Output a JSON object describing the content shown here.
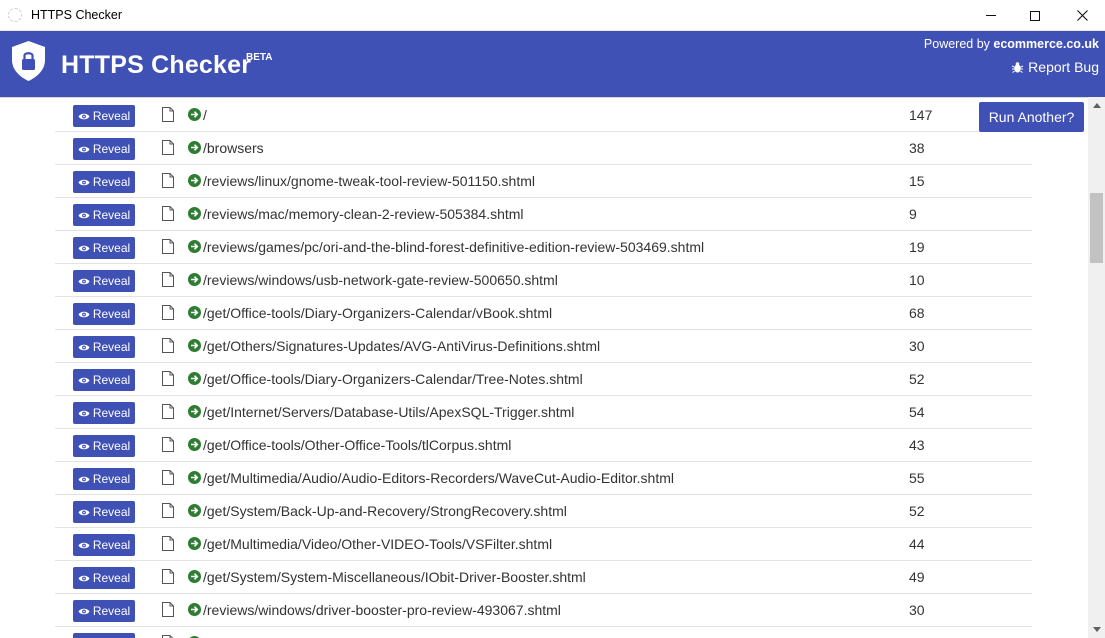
{
  "window": {
    "title": "HTTPS Checker"
  },
  "header": {
    "title": "HTTPS Checker",
    "badge": "BETA",
    "powered_prefix": "Powered by ",
    "powered_brand": "ecommerce.co.uk",
    "report_bug": "Report Bug"
  },
  "actions": {
    "run_another": "Run Another?"
  },
  "results": [
    {
      "reveal": "Reveal",
      "path": "/",
      "count": "147"
    },
    {
      "reveal": "Reveal",
      "path": "/browsers",
      "count": "38"
    },
    {
      "reveal": "Reveal",
      "path": "/reviews/linux/gnome-tweak-tool-review-501150.shtml",
      "count": "15"
    },
    {
      "reveal": "Reveal",
      "path": "/reviews/mac/memory-clean-2-review-505384.shtml",
      "count": "9"
    },
    {
      "reveal": "Reveal",
      "path": "/reviews/games/pc/ori-and-the-blind-forest-definitive-edition-review-503469.shtml",
      "count": "19"
    },
    {
      "reveal": "Reveal",
      "path": "/reviews/windows/usb-network-gate-review-500650.shtml",
      "count": "10"
    },
    {
      "reveal": "Reveal",
      "path": "/get/Office-tools/Diary-Organizers-Calendar/vBook.shtml",
      "count": "68"
    },
    {
      "reveal": "Reveal",
      "path": "/get/Others/Signatures-Updates/AVG-AntiVirus-Definitions.shtml",
      "count": "30"
    },
    {
      "reveal": "Reveal",
      "path": "/get/Office-tools/Diary-Organizers-Calendar/Tree-Notes.shtml",
      "count": "52"
    },
    {
      "reveal": "Reveal",
      "path": "/get/Internet/Servers/Database-Utils/ApexSQL-Trigger.shtml",
      "count": "54"
    },
    {
      "reveal": "Reveal",
      "path": "/get/Office-tools/Other-Office-Tools/tlCorpus.shtml",
      "count": "43"
    },
    {
      "reveal": "Reveal",
      "path": "/get/Multimedia/Audio/Audio-Editors-Recorders/WaveCut-Audio-Editor.shtml",
      "count": "55"
    },
    {
      "reveal": "Reveal",
      "path": "/get/System/Back-Up-and-Recovery/StrongRecovery.shtml",
      "count": "52"
    },
    {
      "reveal": "Reveal",
      "path": "/get/Multimedia/Video/Other-VIDEO-Tools/VSFilter.shtml",
      "count": "44"
    },
    {
      "reveal": "Reveal",
      "path": "/get/System/System-Miscellaneous/IObit-Driver-Booster.shtml",
      "count": "49"
    },
    {
      "reveal": "Reveal",
      "path": "/reviews/windows/driver-booster-pro-review-493067.shtml",
      "count": "30"
    },
    {
      "reveal": "Reveal",
      "path": "",
      "count": ""
    }
  ],
  "colors": {
    "primary": "#3f51b5",
    "go_icon": "#2e7d32",
    "row_border": "#e3e3e3"
  },
  "icons": [
    "shield-lock-icon",
    "bug-icon",
    "eye-icon",
    "file-icon",
    "arrow-circle-right-icon",
    "close-icon"
  ]
}
